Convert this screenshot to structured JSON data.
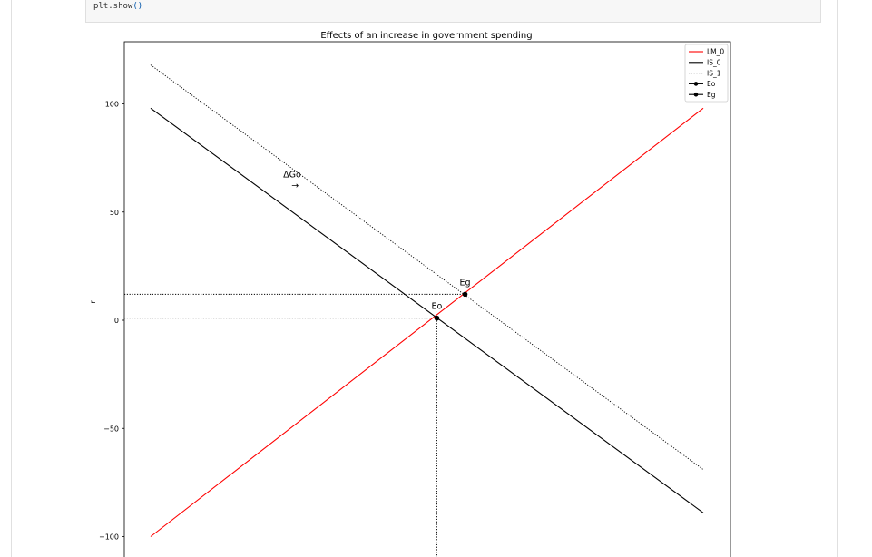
{
  "notebook": {
    "code_prev": "...)",
    "code_line_obj": "plt.show",
    "code_line_paren": "()"
  },
  "colors": {
    "lm": "#ff0000",
    "is0": "#000000",
    "is1": "#000000",
    "point": "#000000"
  },
  "chart_data": {
    "type": "line",
    "title": "Effects of an increase in government spending",
    "xlabel": "",
    "ylabel": "r",
    "ylim": [
      -108,
      129
    ],
    "xlim": [
      0,
      100
    ],
    "yticks": [
      100,
      50,
      0,
      -50,
      -100
    ],
    "ytick_labels": [
      "100",
      "50",
      "0",
      "−50",
      "−100"
    ],
    "grid": false,
    "legend_placement": "top-right",
    "series": [
      {
        "name": "LM_0",
        "style": "solid",
        "color": "#ff0000",
        "x": [
          0,
          100
        ],
        "y": [
          -100,
          98
        ]
      },
      {
        "name": "IS_0",
        "style": "solid",
        "color": "#000000",
        "x": [
          0,
          100
        ],
        "y": [
          98,
          -89
        ]
      },
      {
        "name": "IS_1",
        "style": "dotted",
        "color": "#000000",
        "x": [
          0,
          100
        ],
        "y": [
          118,
          -69
        ]
      }
    ],
    "points": [
      {
        "name": "Eo",
        "x": 51.8,
        "y": 1,
        "label": "Eo"
      },
      {
        "name": "Eg",
        "x": 56.9,
        "y": 12,
        "label": "Eg"
      }
    ],
    "annotations": [
      {
        "text": "ΔGo",
        "x": 24,
        "y": 66
      },
      {
        "text": "→",
        "x": 25.5,
        "y": 61
      }
    ]
  }
}
